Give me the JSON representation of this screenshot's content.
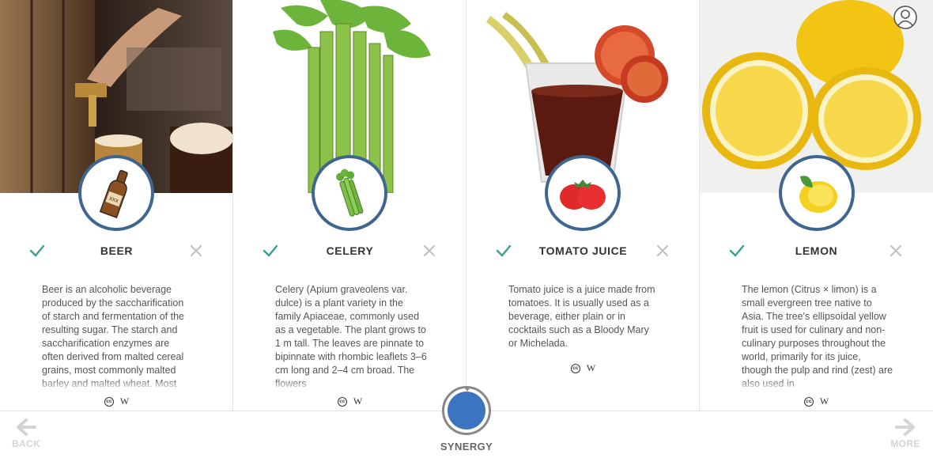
{
  "cards": [
    {
      "name": "BEER",
      "description": "Beer is an alcoholic beverage produced by the saccharification of starch and fermentation of the resulting sugar. The starch and saccharification enzymes are often derived from malted cereal grains, most commonly malted barley and malted wheat. Most",
      "icon": "beer-bottle-icon",
      "credit_source": "W"
    },
    {
      "name": "CELERY",
      "description": "Celery (Apium graveolens var. dulce) is a plant variety in the family Apiaceae, commonly used as a vegetable. The plant grows to 1 m tall. The leaves are pinnate to bipinnate with rhombic leaflets 3–6 cm long and 2–4 cm broad. The flowers",
      "icon": "celery-icon",
      "credit_source": "W"
    },
    {
      "name": "TOMATO JUICE",
      "description": "Tomato juice is a juice made from tomatoes. It is usually used as a beverage, either plain or in cocktails such as a Bloody Mary or Michelada.",
      "icon": "tomato-icon",
      "credit_source": "W"
    },
    {
      "name": "LEMON",
      "description": "The lemon (Citrus × limon) is a small evergreen tree native to Asia. The tree's ellipsoidal yellow fruit is used for culinary and non-culinary purposes throughout the world, primarily for its juice, though the pulp and rind (zest) are also used in",
      "icon": "lemon-icon",
      "credit_source": "W"
    }
  ],
  "credits_cc": "cc",
  "footer": {
    "back_label": "BACK",
    "more_label": "MORE",
    "synergy_label": "SYNERGY"
  },
  "colors": {
    "accent_ring": "#3f6690",
    "check": "#3aa08c",
    "synergy": "#3d74c0"
  }
}
